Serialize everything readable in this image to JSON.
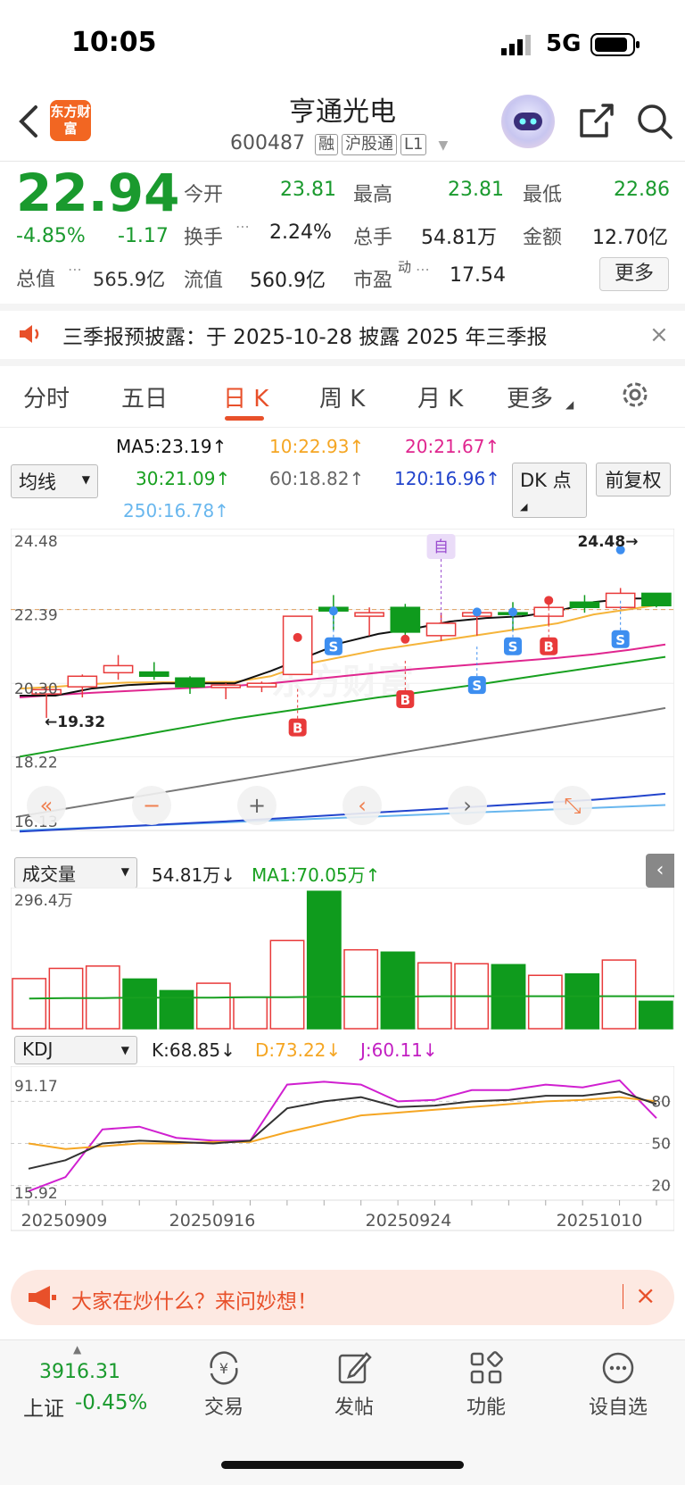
{
  "status_bar": {
    "time": "10:05",
    "network": "5G"
  },
  "header": {
    "title": "亨通光电",
    "code": "600487",
    "tags": [
      "融",
      "沪股通",
      "L1"
    ],
    "logo_text": "东方财富"
  },
  "quote": {
    "price": "22.94",
    "change_pct": "-4.85%",
    "change": "-1.17",
    "total_value_label": "总值",
    "total_value": "565.9亿",
    "fields": {
      "open_label": "今开",
      "open": "23.81",
      "high_label": "最高",
      "high": "23.81",
      "low_label": "最低",
      "low": "22.86",
      "turnover_label": "换手",
      "turnover": "2.24%",
      "volume_label": "总手",
      "volume": "54.81万",
      "amount_label": "金额",
      "amount": "12.70亿",
      "float_label": "流值",
      "float_value": "560.9亿",
      "pe_label": "市盈",
      "pe_sup": "动",
      "pe": "17.54"
    },
    "more_button": "更多"
  },
  "notice": {
    "text": "三季报预披露：于 2025-10-28 披露 2025 年三季报"
  },
  "tabs": [
    "分时",
    "五日",
    "日 K",
    "周 K",
    "月 K",
    "更多"
  ],
  "active_tab": "日 K",
  "ma_legend": {
    "select": "均线",
    "ma5": "MA5:23.19↑",
    "ma10": "10:22.93↑",
    "ma20": "20:21.67↑",
    "ma30": "30:21.09↑",
    "ma60": "60:18.82↑",
    "ma120": "120:16.96↑",
    "ma250": "250:16.78↑",
    "dk_button": "DK 点",
    "adjust_button": "前复权"
  },
  "kline": {
    "y_labels": [
      "24.48",
      "22.39",
      "20.30",
      "18.22",
      "16.13"
    ],
    "max_annotation": "24.48→",
    "min_annotation": "←19.32",
    "marker_zi": "自",
    "marker_s": "S",
    "marker_b": "B",
    "watermark": "东方财富",
    "colors": {
      "up": "#e83a3a",
      "down": "#0f9b1d",
      "ma5": "#111111",
      "ma10": "#f5b43a",
      "ma20": "#e0268f",
      "ma30": "#18a020",
      "ma60": "#777777",
      "ma120": "#2244cc",
      "ma250": "#69b7ee"
    },
    "candles": [
      {
        "o": 20.0,
        "c": 20.12,
        "h": 20.2,
        "l": 19.32,
        "up": true
      },
      {
        "o": 20.2,
        "c": 20.5,
        "h": 20.55,
        "l": 19.9,
        "up": true
      },
      {
        "o": 20.6,
        "c": 20.8,
        "h": 21.1,
        "l": 20.4,
        "up": true
      },
      {
        "o": 20.62,
        "c": 20.5,
        "h": 20.9,
        "l": 20.4,
        "up": false
      },
      {
        "o": 20.45,
        "c": 20.2,
        "h": 20.5,
        "l": 20.0,
        "up": false
      },
      {
        "o": 20.18,
        "c": 20.25,
        "h": 20.3,
        "l": 19.85,
        "up": true
      },
      {
        "o": 20.2,
        "c": 20.3,
        "h": 20.35,
        "l": 20.05,
        "up": true
      },
      {
        "o": 20.55,
        "c": 22.2,
        "h": 22.2,
        "l": 20.55,
        "up": true
      },
      {
        "o": 22.45,
        "c": 22.35,
        "h": 22.8,
        "l": 21.8,
        "up": false
      },
      {
        "o": 22.2,
        "c": 22.3,
        "h": 22.45,
        "l": 21.65,
        "up": true
      },
      {
        "o": 22.45,
        "c": 21.75,
        "h": 22.55,
        "l": 21.5,
        "up": false
      },
      {
        "o": 21.65,
        "c": 22.0,
        "h": 22.3,
        "l": 21.5,
        "up": true
      },
      {
        "o": 22.2,
        "c": 22.3,
        "h": 22.4,
        "l": 21.65,
        "up": true
      },
      {
        "o": 22.3,
        "c": 22.25,
        "h": 22.6,
        "l": 21.8,
        "up": false
      },
      {
        "o": 22.2,
        "c": 22.45,
        "h": 22.6,
        "l": 21.95,
        "up": true
      },
      {
        "o": 22.45,
        "c": 22.6,
        "h": 22.8,
        "l": 22.3,
        "up": false
      },
      {
        "o": 22.45,
        "c": 22.85,
        "h": 23.0,
        "l": 22.4,
        "up": true
      },
      {
        "o": 22.85,
        "c": 22.5,
        "h": 22.85,
        "l": 22.45,
        "up": false
      }
    ],
    "ma5_line": [
      19.95,
      19.95,
      20.15,
      20.25,
      20.3,
      20.3,
      20.3,
      20.65,
      21.05,
      21.45,
      21.7,
      21.85,
      22.05,
      22.15,
      22.2,
      22.35,
      22.6,
      22.7,
      22.7
    ],
    "ma10_line": [
      20.15,
      20.2,
      20.28,
      20.32,
      20.33,
      20.33,
      20.34,
      20.5,
      20.85,
      21.05,
      21.25,
      21.4,
      21.55,
      21.7,
      21.85,
      22.0,
      22.25,
      22.4,
      22.55
    ],
    "ma20_line": [
      19.9,
      19.97,
      20.03,
      20.08,
      20.13,
      20.18,
      20.23,
      20.3,
      20.4,
      20.5,
      20.6,
      20.7,
      20.78,
      20.86,
      20.94,
      21.02,
      21.12,
      21.25,
      21.4
    ],
    "ma30_line": [
      18.22,
      18.4,
      18.58,
      18.76,
      18.94,
      19.12,
      19.3,
      19.45,
      19.6,
      19.75,
      19.9,
      20.02,
      20.16,
      20.3,
      20.45,
      20.6,
      20.75,
      20.9,
      21.05
    ],
    "ma60_line": [
      16.53,
      16.7,
      16.87,
      17.04,
      17.21,
      17.38,
      17.55,
      17.72,
      17.89,
      18.06,
      18.23,
      18.4,
      18.57,
      18.74,
      18.91,
      19.08,
      19.25,
      19.42,
      19.6
    ],
    "ma120_line": [
      16.1,
      16.15,
      16.2,
      16.25,
      16.3,
      16.35,
      16.4,
      16.46,
      16.52,
      16.58,
      16.64,
      16.7,
      16.76,
      16.82,
      16.88,
      16.94,
      17.0,
      17.08,
      17.17
    ],
    "ma250_line": [
      16.13,
      16.17,
      16.21,
      16.25,
      16.29,
      16.33,
      16.37,
      16.41,
      16.45,
      16.49,
      16.53,
      16.57,
      16.61,
      16.65,
      16.69,
      16.73,
      16.77,
      16.81,
      16.85
    ],
    "nav_buttons": [
      "«",
      "−",
      "+",
      "‹",
      "›",
      "⤡"
    ]
  },
  "volume_panel": {
    "select": "成交量",
    "value": "54.81万↓",
    "ma1": "MA1:70.05万↑",
    "max_label": "296.4万",
    "bars": [
      108,
      130,
      135,
      107,
      82,
      98,
      68,
      190,
      296,
      170,
      165,
      142,
      140,
      138,
      115,
      118,
      148,
      59
    ],
    "ma_line": [
      65,
      66,
      66,
      67,
      67,
      67,
      68,
      68,
      69,
      69,
      69,
      70,
      70,
      70,
      70,
      70,
      70,
      70,
      70
    ]
  },
  "kdj_panel": {
    "select": "KDJ",
    "k": "K:68.85↓",
    "d": "D:73.22↓",
    "j": "J:60.11↓",
    "left_labels": [
      "91.17",
      "15.92"
    ],
    "right_labels": [
      "80",
      "50",
      "20"
    ],
    "k_line": [
      32,
      38,
      50,
      52,
      51,
      50,
      52,
      75,
      80,
      83,
      76,
      77,
      80,
      81,
      84,
      84,
      87,
      78
    ],
    "d_line": [
      50,
      46,
      48,
      50,
      50,
      51,
      51,
      58,
      64,
      70,
      72,
      74,
      76,
      78,
      80,
      81,
      83,
      80
    ],
    "j_line": [
      16,
      26,
      60,
      62,
      54,
      52,
      52,
      92,
      94,
      92,
      80,
      81,
      88,
      88,
      92,
      90,
      95,
      68
    ],
    "dates": [
      "20250909",
      "20250916",
      "20250924",
      "20251010"
    ]
  },
  "promo": {
    "text": "大家在炒什么？来问妙想！"
  },
  "bottom_nav": {
    "index_value": "3916.31",
    "index_name": "上证",
    "index_change": "-0.45%",
    "items": [
      {
        "label": "交易",
        "icon": "yuan-exchange-icon"
      },
      {
        "label": "发帖",
        "icon": "edit-icon"
      },
      {
        "label": "功能",
        "icon": "grid-icon"
      },
      {
        "label": "设自选",
        "icon": "more-circle-icon"
      }
    ]
  }
}
